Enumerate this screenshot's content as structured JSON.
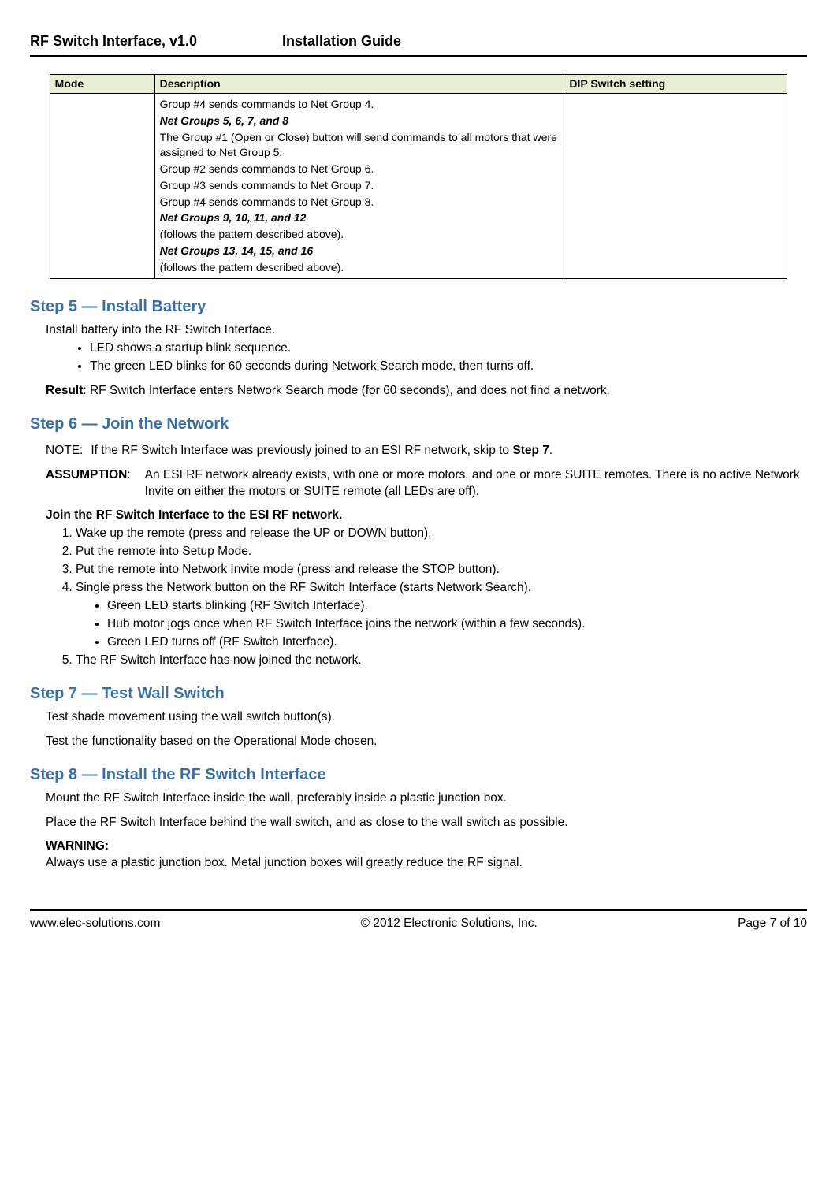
{
  "header": {
    "product": "RF Switch Interface, v1.0",
    "doc_type": "Installation Guide"
  },
  "table": {
    "head_mode": "Mode",
    "head_desc": "Description",
    "head_dip": "DIP Switch setting",
    "desc": {
      "l1": "Group #4 sends commands to Net Group 4.",
      "h1": "Net Groups 5, 6, 7, and 8",
      "l2": "The Group #1 (Open or Close) button will send commands to all motors that were assigned to Net Group 5.",
      "l3": "Group #2 sends commands to Net Group 6.",
      "l4": "Group #3 sends commands to Net Group 7.",
      "l5": "Group #4 sends commands to Net Group 8.",
      "h2": "Net Groups 9, 10, 11, and 12",
      "l6": "(follows the pattern described above).",
      "h3": "Net Groups 13, 14, 15, and 16",
      "l7": "(follows the pattern described above)."
    }
  },
  "step5": {
    "heading": "Step 5 — Install Battery",
    "intro": "Install battery into the RF Switch Interface.",
    "b1": "LED shows a startup blink sequence.",
    "b2": "The green LED blinks for 60 seconds during Network Search mode, then turns off.",
    "result_label": "Result",
    "result_text": ": RF Switch Interface enters Network Search mode (for 60 seconds), and does not find a network."
  },
  "step6": {
    "heading": "Step 6 — Join the Network",
    "note_label": "NOTE:",
    "note_text_pre": "If the RF Switch Interface was previously joined to an ESI RF network, skip to ",
    "note_bold": "Step 7",
    "note_text_post": ".",
    "assumption_label": "ASSUMPTION",
    "assumption_colon": ":",
    "assumption_text": "An ESI RF network already exists, with one or more motors, and one or more SUITE remotes. There is no active Network Invite on either the motors or SUITE remote (all LEDs are off).",
    "join_heading": "Join the RF Switch Interface to the ESI RF network.",
    "o1": "Wake up the remote (press and release the UP or DOWN button).",
    "o2": "Put the remote into Setup Mode.",
    "o3": "Put the remote into Network Invite mode (press and release the STOP button).",
    "o4": "Single press the Network button on the RF Switch Interface (starts Network Search).",
    "sb1": "Green LED starts blinking (RF Switch Interface).",
    "sb2": "Hub motor jogs once when RF Switch Interface joins the network (within a few seconds).",
    "sb3": "Green LED turns off (RF Switch Interface).",
    "o5": "The RF Switch Interface has now joined the network."
  },
  "step7": {
    "heading": "Step 7 — Test Wall Switch",
    "p1": "Test shade movement using the wall switch button(s).",
    "p2": "Test the functionality based on the Operational Mode chosen."
  },
  "step8": {
    "heading": "Step 8 — Install the RF Switch Interface",
    "p1": "Mount the RF Switch Interface inside the wall, preferably inside a plastic junction box.",
    "p2": "Place  the RF Switch Interface behind the wall switch, and as close to the wall switch as possible.",
    "warn_label": "WARNING:",
    "warn_text": "Always use a plastic junction box. Metal junction boxes will greatly reduce the RF signal."
  },
  "footer": {
    "left": "www.elec-solutions.com",
    "center": "© 2012 Electronic Solutions, Inc.",
    "right": "Page 7 of 10"
  }
}
